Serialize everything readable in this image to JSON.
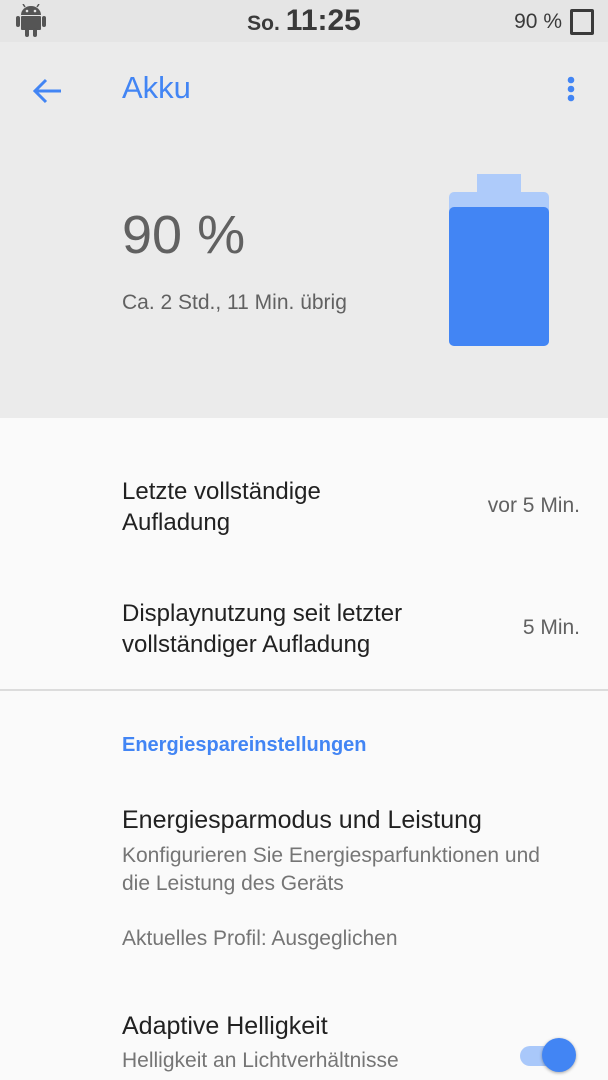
{
  "status_bar": {
    "day": "So.",
    "time": "11:25",
    "battery_text": "90 %",
    "icons": [
      "android-icon",
      "battery-outline-icon"
    ]
  },
  "toolbar": {
    "title": "Akku",
    "back_icon": "arrow-back-icon",
    "menu_icon": "more-vert-icon"
  },
  "battery": {
    "percent_text": "90 %",
    "level": 0.9,
    "remaining": "Ca. 2 Std., 11 Min. übrig"
  },
  "stats": [
    {
      "label": "Letzte vollständige Aufladung",
      "value": "vor 5 Min."
    },
    {
      "label": "Displaynutzung seit letzter vollständiger Aufladung",
      "value": "5 Min."
    }
  ],
  "section": {
    "title": "Energiespareinstellungen"
  },
  "preferences": [
    {
      "title": "Energiesparmodus und Leistung",
      "summary": "Konfigurieren Sie Energiesparfunktionen und die Leistung des Geräts",
      "extra": "Aktuelles Profil: Ausgeglichen"
    },
    {
      "title": "Adaptive Helligkeit",
      "summary": "Helligkeit an Lichtverhältnisse",
      "toggle_on": true
    }
  ],
  "colors": {
    "accent": "#4285f4",
    "header_bg": "#ebebeb",
    "status_bar_bg": "#e5e5e5"
  }
}
